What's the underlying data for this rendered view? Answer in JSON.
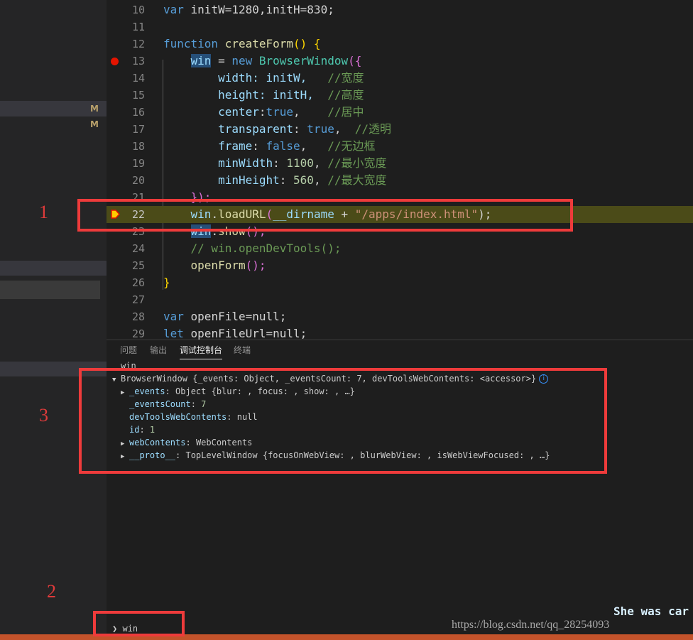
{
  "sidebar": {
    "modified_badges": [
      "M",
      "M"
    ]
  },
  "editor": {
    "line_numbers": [
      "10",
      "11",
      "12",
      "13",
      "14",
      "15",
      "16",
      "17",
      "18",
      "19",
      "20",
      "21",
      "22",
      "23",
      "24",
      "25",
      "26",
      "27",
      "28",
      "29"
    ],
    "lines": {
      "l10": {
        "kw": "var",
        "rest": " initW=1280,initH=830;"
      },
      "l12": {
        "kw": "function",
        "fn": "createForm",
        "rest": "() {"
      },
      "l13": {
        "var": "win",
        "eq": " = ",
        "kw": "new",
        "cls": "BrowserWindow",
        "rest": "({"
      },
      "l14": {
        "prop": "width",
        "val": ": initW,",
        "comment": "//宽度"
      },
      "l15": {
        "prop": "height",
        "val": ": initH,",
        "comment": "//高度"
      },
      "l16": {
        "prop": "center",
        "val": ":",
        "kw": "true",
        "tail": ",",
        "comment": "//居中"
      },
      "l17": {
        "prop": "transparent",
        "val": ": ",
        "kw": "true",
        "tail": ",",
        "comment": "//透明"
      },
      "l18": {
        "prop": "frame",
        "val": ": ",
        "kw": "false",
        "tail": ",",
        "comment": "//无边框"
      },
      "l19": {
        "prop": "minWidth",
        "val": ": ",
        "num": "1100",
        "tail": ",",
        "comment": "//最小宽度"
      },
      "l20": {
        "prop": "minHeight",
        "val": ": ",
        "num": "560",
        "tail": ",",
        "comment": "//最大宽度"
      },
      "l21": {
        "text": "});"
      },
      "l22": {
        "var": "win",
        "dot": ".",
        "fn": "loadURL",
        "open": "(",
        "arg": "__dirname",
        "plus": " + ",
        "str": "\"/apps/index.html\"",
        "close": ");"
      },
      "l23": {
        "var": "win",
        "dot": ".",
        "fn": "show",
        "rest": "();"
      },
      "l24": {
        "comment": "// win.openDevTools();"
      },
      "l25": {
        "fn": "openForm",
        "rest": "();"
      },
      "l26": {
        "text": "}"
      },
      "l28": {
        "kw": "var",
        "rest": " openFile=null;"
      },
      "l29": {
        "kw": "let",
        "rest": " openFileUrl=null;"
      }
    }
  },
  "panel": {
    "tabs": [
      "问题",
      "输出",
      "调试控制台",
      "终端"
    ],
    "active_tab": "调试控制台",
    "console": {
      "echo": "win",
      "root": {
        "name": "BrowserWindow",
        "summary": " {_events: Object, _eventsCount: 7, devToolsWebContents: <accessor>}"
      },
      "props": [
        {
          "key": "_events",
          "value": "Object {blur: , focus: , show: , …}",
          "expandable": true
        },
        {
          "key": "_eventsCount",
          "value": "7",
          "expandable": false
        },
        {
          "key": "devToolsWebContents",
          "value": "null",
          "expandable": false
        },
        {
          "key": "id",
          "value": "1",
          "expandable": false
        },
        {
          "key": "webContents",
          "value": "WebContents",
          "expandable": true
        },
        {
          "key": "__proto__",
          "value": "TopLevelWindow {focusOnWebView: , blurWebView: , isWebViewFocused: , …}",
          "expandable": true
        }
      ],
      "input_value": "win",
      "input_prompt": "❯"
    }
  },
  "annotations": {
    "one": "1",
    "two": "2",
    "three": "3"
  },
  "overlay": {
    "subtitle": "She was car",
    "watermark": "https://blog.csdn.net/qq_28254093"
  },
  "colors": {
    "breakpoint": "#e51400",
    "current_line": "#4b4b18",
    "annotation": "#ee3b3b",
    "statusbar": "#c4532b"
  }
}
